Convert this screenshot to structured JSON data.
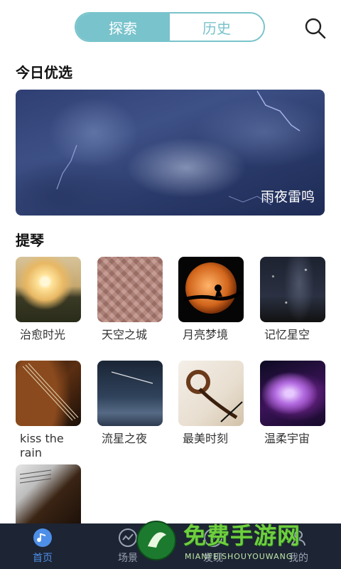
{
  "header": {
    "tabs": [
      {
        "label": "探索",
        "active": true
      },
      {
        "label": "历史",
        "active": false
      }
    ],
    "search_icon": "search-icon",
    "accent": "#79c3cc"
  },
  "featured": {
    "section_title": "今日优选",
    "caption": "雨夜雷鸣"
  },
  "category": {
    "title": "提琴",
    "items": [
      {
        "label": "治愈时光"
      },
      {
        "label": "天空之城"
      },
      {
        "label": "月亮梦境"
      },
      {
        "label": "记忆星空"
      },
      {
        "label": "kiss the rain"
      },
      {
        "label": "流星之夜"
      },
      {
        "label": "最美时刻"
      },
      {
        "label": "温柔宇宙"
      },
      {
        "label": ""
      }
    ]
  },
  "bottom_nav": {
    "items": [
      {
        "label": "首页",
        "icon": "music-note-icon",
        "active": true
      },
      {
        "label": "场景",
        "icon": "trend-icon",
        "active": false
      },
      {
        "label": "发现",
        "icon": "discover-icon",
        "active": false
      },
      {
        "label": "我的",
        "icon": "profile-icon",
        "active": false
      }
    ],
    "active_color": "#4d8fe8",
    "background": "#1d2433"
  },
  "watermark": {
    "title": "免费手游网",
    "subtitle": "MIANFEISHOUYOUWANG"
  }
}
